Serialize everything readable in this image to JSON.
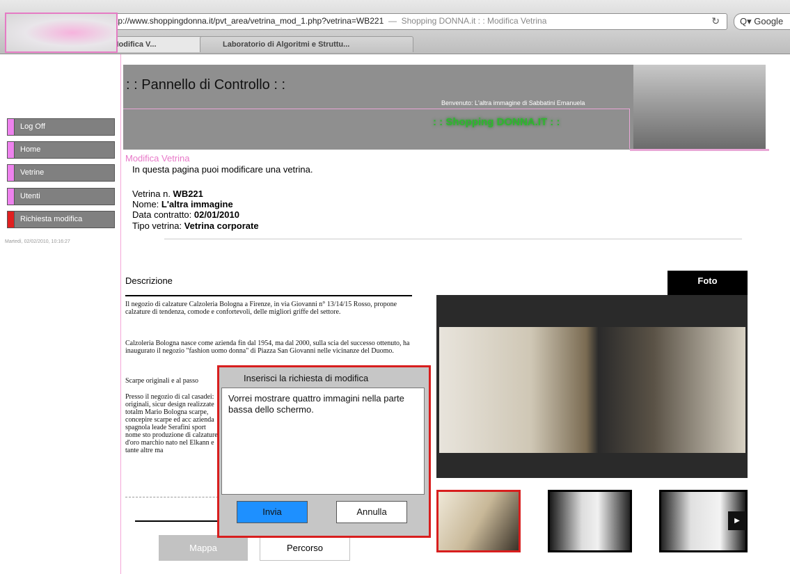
{
  "browser": {
    "back_icon": "◀",
    "forward_icon": "▶",
    "new_tab_icon": "+",
    "url": "http://www.shoppingdonna.it/pvt_area/vetrina_mod_1.php?vetrina=WB221",
    "page_title": "Shopping DONNA.it : : Modifica Vetrina",
    "search_placeholder": "Q▾ Google",
    "reload_icon": "↻",
    "tabs": [
      {
        "label": "Shopping DONNA.it : : Modifica V..."
      },
      {
        "label": "Laboratorio di Algoritmi e Struttu..."
      }
    ]
  },
  "sidebar": {
    "items": [
      {
        "label": "Log Off"
      },
      {
        "label": "Home"
      },
      {
        "label": "Vetrine"
      },
      {
        "label": "Utenti"
      },
      {
        "label": "Richiesta modifica"
      }
    ],
    "date": "Martedì, 02/02/2010, 10:16:27"
  },
  "header": {
    "title": ": : Pannello di Controllo : :",
    "welcome": "Benvenuto: L'altra immagine di Sabbatini Emanuela",
    "shop_name": ": : Shopping DONNA.IT : :"
  },
  "page": {
    "section": "Modifica Vetrina",
    "intro": "In questa pagina puoi modificare una vetrina.",
    "vetrina_label": "Vetrina n. ",
    "vetrina_value": "WB221",
    "nome_label": "Nome: ",
    "nome_value": "L'altra immagine",
    "data_label": "Data contratto: ",
    "data_value": "02/01/2010",
    "tipo_label": "Tipo vetrina: ",
    "tipo_value": "Vetrina corporate",
    "descrizione_label": "Descrizione",
    "paragraphs": [
      "Il negozio di calzature Calzoleria Bologna a Firenze, in via Giovanni n° 13/14/15 Rosso, propone calzature di tendenza, comode e confortevoli, delle migliori griffe del settore.",
      "Calzoleria Bologna nasce come azienda fin dal 1954, ma dal 2000, sulla scia del successo ottenuto, ha inaugurato il negozio \"fashion uomo donna\" di Piazza San Giovanni nelle vicinanze del Duomo.",
      "Scarpe originali e al passo",
      "Presso il negozio di cal casadei: originali, sicur design realizzate totalm Mario Bologna scarpe, concepire scarpe ed acc azienda spagnola leade Serafini sport nome sto produzione di calzature d'oro marchio nato nel Elkann e tante altre ma"
    ],
    "mappa_label": "Mappa",
    "percorso_label": "Percorso",
    "foto_label": "Foto",
    "next_icon": "▶"
  },
  "modal": {
    "title": "Inserisci la richiesta di modifica",
    "text": "Vorrei mostrare quattro immagini nella parte bassa dello schermo.",
    "send_label": "Invia",
    "cancel_label": "Annulla"
  },
  "colors": {
    "accent_pink": "#e878c8",
    "sidebar_gray": "#808080",
    "modal_border": "#d81e1e",
    "send_button": "#1e90ff"
  }
}
